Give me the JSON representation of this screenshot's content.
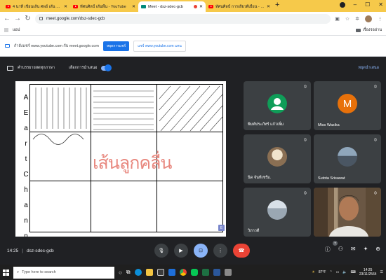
{
  "browser": {
    "tabs": [
      {
        "title": "4 นาที เขียนเส้น ศพย์ เส้น 5 แบบ -",
        "icon": "youtube-icon",
        "active": false
      },
      {
        "title": "ทัศนศิลป์ เส้นพื้น - YouTube",
        "icon": "youtube-icon",
        "active": false
      },
      {
        "title": "Meet - dsz-sdec-gcb",
        "icon": "meet-icon",
        "active": true
      },
      {
        "title": "ทัศนศิลป์ การเสียวตีเยี้ยน - YouTube",
        "icon": "youtube-icon",
        "active": false
      }
    ],
    "url": "meet.google.com/dsz-sdec-gcb",
    "bookmarks_apps": "แอป",
    "bookmarks_reading_list": "เรื่องรออ่าน"
  },
  "share_bar": {
    "message": "กำลังแชร์ www.youtube.com กับ meet.google.com",
    "stop_label": "หยุดการแชร์",
    "share_tab_label": "แชร์ www.youtube.com แทน"
  },
  "meet_top": {
    "caption_label": "คำบรรยายสดทุกภาษา",
    "pin_label": "เลือกการนำเสนอ",
    "right_link": "หยุดนำเสนอ"
  },
  "presentation": {
    "vertical_title": [
      "A",
      "E",
      "a",
      "r",
      "t",
      "C",
      "h",
      "a",
      "n",
      "n",
      "e",
      "l"
    ],
    "center_text": "เส้นลูกคลื่น",
    "presenter_badge": "E"
  },
  "participants": [
    {
      "name": "พิมพ์ประภัทร์ แก้วเพิ่ม",
      "avatar": "person-silhouette",
      "color": "#0f9d58"
    },
    {
      "name": "Miss Wasika",
      "avatar": "letter",
      "letter": "M",
      "color": "#e8710a"
    },
    {
      "name": "นิด จันท์เชร์ม.",
      "avatar": "photo",
      "color": "#d7c5a6"
    },
    {
      "name": "Sutota Srisawat",
      "avatar": "photo",
      "color": "#6f7f8e"
    },
    {
      "name": "วิภาวดี",
      "avatar": "photo",
      "color": "#b9c4cf"
    },
    {
      "name": "",
      "avatar": "video",
      "color": "#7a5f44"
    }
  ],
  "controls": {
    "time": "14:25",
    "meeting_code": "dsz-sdec-gcb",
    "participant_count": "7"
  },
  "taskbar": {
    "search_placeholder": "Type here to search",
    "temperature": "87°F",
    "time": "14:25",
    "date": "23/11/2564"
  }
}
